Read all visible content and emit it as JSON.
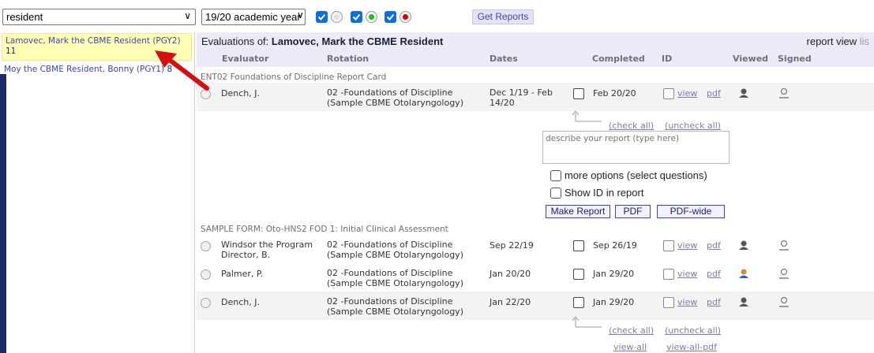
{
  "filters": {
    "role_select": "resident",
    "year_select": "19/20 academic year",
    "get_reports_label": "Get Reports",
    "status_colors": {
      "blank": "#d9d9d9",
      "green": "#1dbf1d",
      "red": "#d40000"
    }
  },
  "sidebar": {
    "residents": [
      {
        "name": "Lamovec, Mark the CBME Resident (PGY2)",
        "count": "11",
        "active": true
      },
      {
        "name": "Moy the CBME Resident, Bonny (PGY1)",
        "count": "8",
        "active": false
      }
    ]
  },
  "header": {
    "title_prefix": "Evaluations of:",
    "resident_name": "Lamovec, Mark the CBME Resident",
    "report_view": "report view",
    "list_link": "lis",
    "columns": [
      "Evaluator",
      "Rotation",
      "Dates",
      "Completed",
      "ID",
      "Viewed",
      "Signed"
    ]
  },
  "sections": [
    {
      "title": "ENT02 Foundations of Discipline Report Card",
      "rows": [
        {
          "evaluator": "Dench, J.",
          "rotation": "02 -Foundations of Discipline (Sample CBME Otolaryngology)",
          "dates": "Dec 1/19 - Feb 14/20",
          "completed": "Feb 20/20",
          "view": "view",
          "pdf": "pdf"
        }
      ]
    },
    {
      "title": "SAMPLE FORM: Oto-HNS2 FOD 1: Initial Clinical Assessment",
      "rows": [
        {
          "evaluator": "Windsor the Program Director, B.",
          "rotation": "02 -Foundations of Discipline (Sample CBME Otolaryngology)",
          "dates": "Sep 22/19",
          "completed": "Sep 26/19",
          "view": "view",
          "pdf": "pdf"
        },
        {
          "evaluator": "Palmer, P.",
          "rotation": "02 -Foundations of Discipline (Sample CBME Otolaryngology)",
          "dates": "Jan 20/20",
          "completed": "Jan 29/20",
          "view": "view",
          "pdf": "pdf"
        },
        {
          "evaluator": "Dench, J.",
          "rotation": "02 -Foundations of Discipline (Sample CBME Otolaryngology)",
          "dates": "Jan 22/20",
          "completed": "Jan 29/20",
          "view": "view",
          "pdf": "pdf"
        }
      ]
    }
  ],
  "report_panel": {
    "check_all": "(check all)",
    "uncheck_all": "(uncheck all)",
    "description_placeholder": "describe your report (type here)",
    "more_options": "more options (select questions)",
    "show_id": "Show ID in report",
    "make_report": "Make Report",
    "pdf": "PDF",
    "pdf_wide": "PDF-wide"
  },
  "footer_links": {
    "check_all": "(check all)",
    "uncheck_all": "(uncheck all)",
    "view_all": "view-all",
    "view_all_pdf": "view-all-pdf"
  },
  "icons": {
    "viewed": "person-viewed-icon",
    "signed": "person-signed-icon",
    "annotation": "red-arrow-annotation"
  }
}
